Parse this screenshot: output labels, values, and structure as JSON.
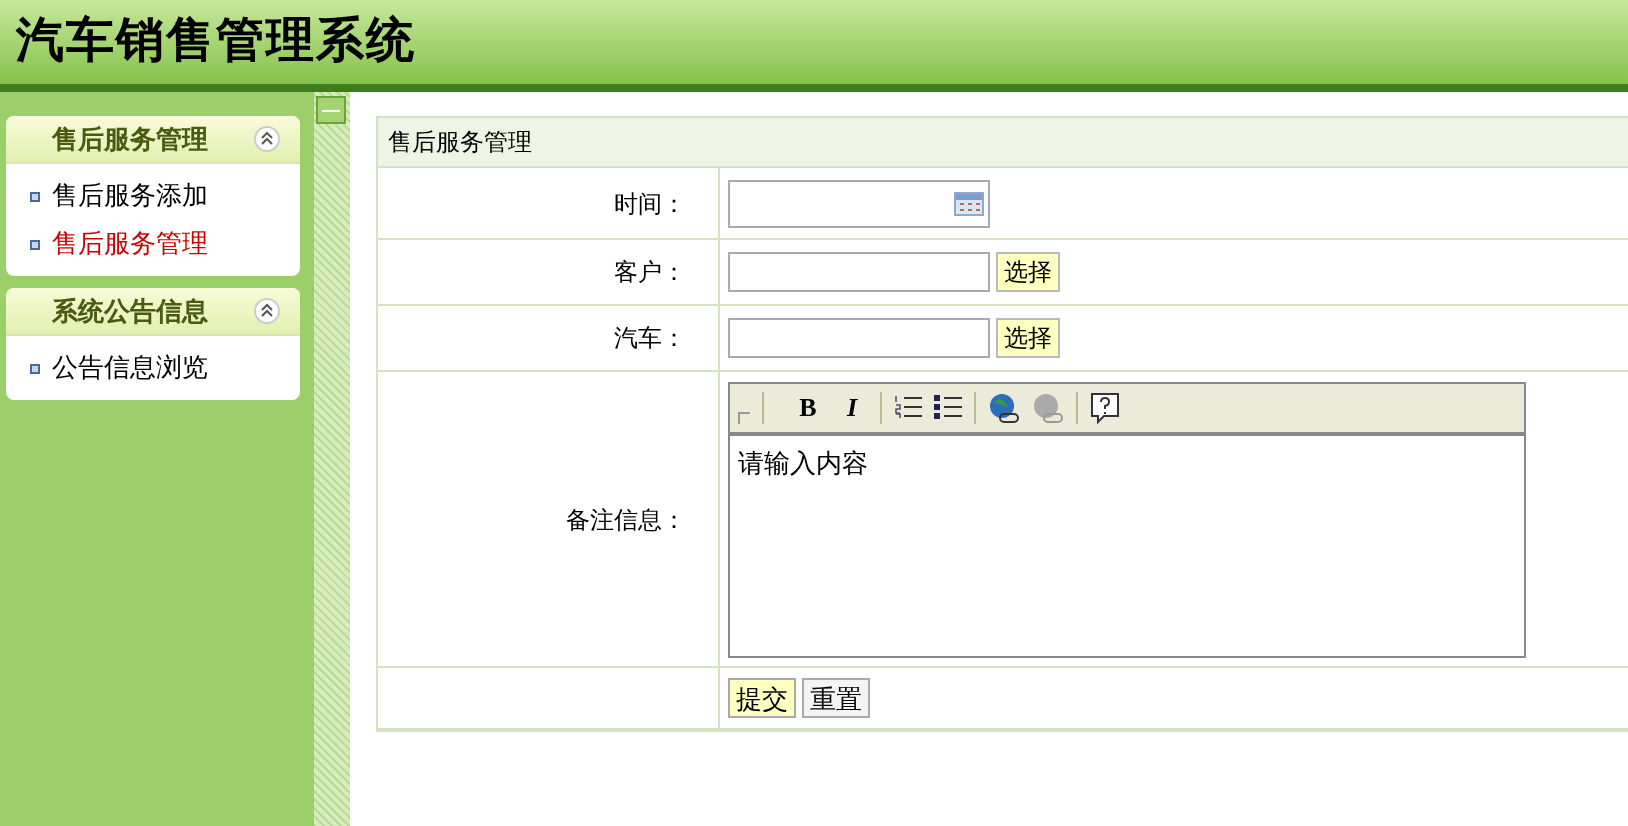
{
  "header": {
    "title": "汽车销售管理系统"
  },
  "sidebar": {
    "groups": [
      {
        "title": "售后服务管理",
        "expanded": true,
        "items": [
          {
            "label": "售后服务添加",
            "selected": false
          },
          {
            "label": "售后服务管理",
            "selected": true
          }
        ]
      },
      {
        "title": "系统公告信息",
        "expanded": true,
        "items": [
          {
            "label": "公告信息浏览",
            "selected": false
          }
        ]
      }
    ]
  },
  "form": {
    "title": "售后服务管理",
    "fields": [
      {
        "kind": "date",
        "label": "时间："
      },
      {
        "kind": "select",
        "label": "客户：",
        "button": "选择"
      },
      {
        "kind": "select",
        "label": "汽车：",
        "button": "选择"
      },
      {
        "kind": "editor",
        "label": "备注信息：",
        "value": "请输入内容",
        "toolbar": {
          "bold": "B",
          "italic": "I"
        }
      }
    ],
    "buttons": [
      {
        "label": "提交",
        "primary": true
      },
      {
        "label": "重置",
        "primary": false
      }
    ]
  }
}
